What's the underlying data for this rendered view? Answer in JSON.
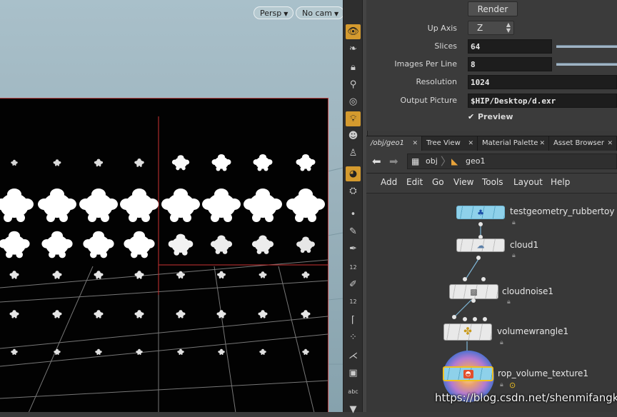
{
  "viewport": {
    "camera_label": "Persp",
    "display_label": "No cam"
  },
  "shelf_icons": [
    "eye-icon",
    "leaf-icon",
    "lock-icon",
    "pin-icon",
    "sphere-icon",
    "bulb-icon",
    "person-icon",
    "figure-icon",
    "shaded-icon",
    "camera-icon",
    "dot-icon",
    "brush-icon",
    "pen-icon",
    "point-number-icon",
    "wire-icon",
    "prim-number-icon",
    "angle-icon",
    "snap-icon",
    "handle-icon",
    "circle-icon",
    "text-icon",
    "down-icon"
  ],
  "shelf_texts": {
    "point_number": "12",
    "prim_number": "12",
    "text": "abc"
  },
  "params": {
    "render_label": "Render",
    "up_axis_label": "Up Axis",
    "up_axis_value": "Z",
    "slices_label": "Slices",
    "slices_value": "64",
    "images_per_line_label": "Images Per Line",
    "images_per_line_value": "8",
    "resolution_label": "Resolution",
    "resolution_value": "1024",
    "output_picture_label": "Output Picture",
    "output_picture_value": "$HIP/Desktop/d.exr",
    "preview_label": "Preview",
    "preview_checked": true
  },
  "tabs": [
    {
      "label": "/obj/geo1"
    },
    {
      "label": "Tree View"
    },
    {
      "label": "Material Palette"
    },
    {
      "label": "Asset Browser"
    }
  ],
  "path": {
    "obj": "obj",
    "geo": "geo1"
  },
  "menu": [
    "Add",
    "Edit",
    "Go",
    "View",
    "Tools",
    "Layout",
    "Help"
  ],
  "nodes": [
    {
      "name": "testgeometry_rubbertoy"
    },
    {
      "name": "cloud1"
    },
    {
      "name": "cloudnoise1"
    },
    {
      "name": "volumewrangle1"
    },
    {
      "name": "rop_volume_texture1"
    }
  ],
  "watermark": "https://blog.csdn.net/shenmifangke",
  "colors": {
    "accent": "#d49a2e",
    "selection": "#f0c020",
    "grid": "#b44"
  }
}
